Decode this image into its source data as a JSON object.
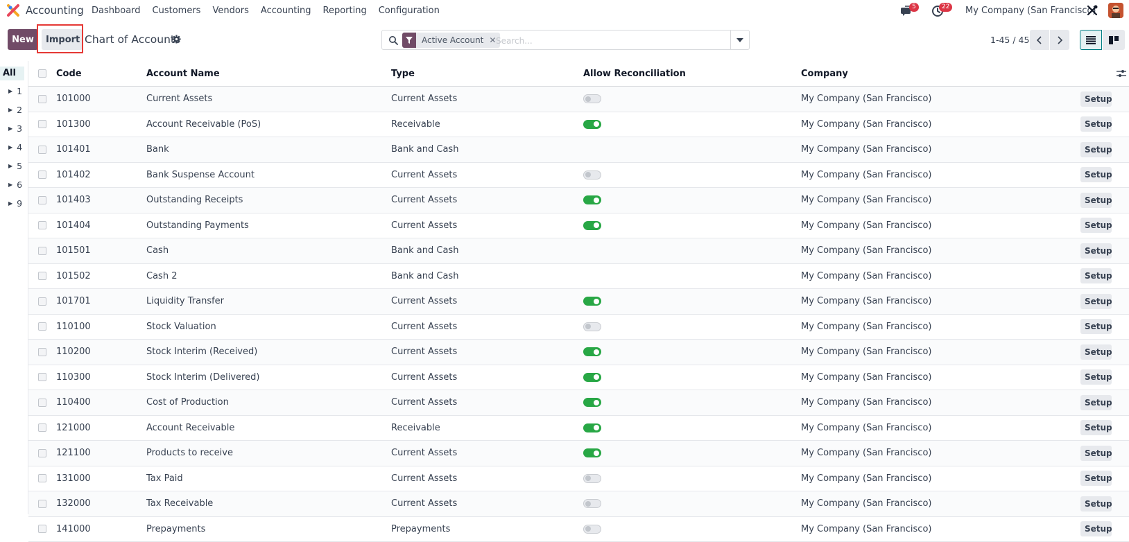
{
  "navbar": {
    "app_name": "Accounting",
    "menu": [
      "Dashboard",
      "Customers",
      "Vendors",
      "Accounting",
      "Reporting",
      "Configuration"
    ],
    "chat_badge": "5",
    "activity_badge": "22",
    "company": "My Company (San Francisco)"
  },
  "control": {
    "new_label": "New",
    "import_label": "Import",
    "title": "Chart of Accounts",
    "facet_label": "Active Account",
    "search_placeholder": "Search...",
    "pager": "1-45 / 45"
  },
  "side_panel": {
    "all_label": "All",
    "groups": [
      "1",
      "2",
      "3",
      "4",
      "5",
      "6",
      "9"
    ]
  },
  "table": {
    "headers": {
      "code": "Code",
      "name": "Account Name",
      "type": "Type",
      "reconcile": "Allow Reconciliation",
      "company": "Company"
    },
    "setup_label": "Setup",
    "rows": [
      {
        "code": "101000",
        "name": "Current Assets",
        "type": "Current Assets",
        "reconcile": "off",
        "company": "My Company (San Francisco)"
      },
      {
        "code": "101300",
        "name": "Account Receivable (PoS)",
        "type": "Receivable",
        "reconcile": "on",
        "company": "My Company (San Francisco)"
      },
      {
        "code": "101401",
        "name": "Bank",
        "type": "Bank and Cash",
        "reconcile": "none",
        "company": "My Company (San Francisco)"
      },
      {
        "code": "101402",
        "name": "Bank Suspense Account",
        "type": "Current Assets",
        "reconcile": "off",
        "company": "My Company (San Francisco)"
      },
      {
        "code": "101403",
        "name": "Outstanding Receipts",
        "type": "Current Assets",
        "reconcile": "on",
        "company": "My Company (San Francisco)"
      },
      {
        "code": "101404",
        "name": "Outstanding Payments",
        "type": "Current Assets",
        "reconcile": "on",
        "company": "My Company (San Francisco)"
      },
      {
        "code": "101501",
        "name": "Cash",
        "type": "Bank and Cash",
        "reconcile": "none",
        "company": "My Company (San Francisco)"
      },
      {
        "code": "101502",
        "name": "Cash 2",
        "type": "Bank and Cash",
        "reconcile": "none",
        "company": "My Company (San Francisco)"
      },
      {
        "code": "101701",
        "name": "Liquidity Transfer",
        "type": "Current Assets",
        "reconcile": "on",
        "company": "My Company (San Francisco)"
      },
      {
        "code": "110100",
        "name": "Stock Valuation",
        "type": "Current Assets",
        "reconcile": "off",
        "company": "My Company (San Francisco)"
      },
      {
        "code": "110200",
        "name": "Stock Interim (Received)",
        "type": "Current Assets",
        "reconcile": "on",
        "company": "My Company (San Francisco)"
      },
      {
        "code": "110300",
        "name": "Stock Interim (Delivered)",
        "type": "Current Assets",
        "reconcile": "on",
        "company": "My Company (San Francisco)"
      },
      {
        "code": "110400",
        "name": "Cost of Production",
        "type": "Current Assets",
        "reconcile": "on",
        "company": "My Company (San Francisco)"
      },
      {
        "code": "121000",
        "name": "Account Receivable",
        "type": "Receivable",
        "reconcile": "on",
        "company": "My Company (San Francisco)"
      },
      {
        "code": "121100",
        "name": "Products to receive",
        "type": "Current Assets",
        "reconcile": "on",
        "company": "My Company (San Francisco)"
      },
      {
        "code": "131000",
        "name": "Tax Paid",
        "type": "Current Assets",
        "reconcile": "off",
        "company": "My Company (San Francisco)"
      },
      {
        "code": "132000",
        "name": "Tax Receivable",
        "type": "Current Assets",
        "reconcile": "off",
        "company": "My Company (San Francisco)"
      },
      {
        "code": "141000",
        "name": "Prepayments",
        "type": "Prepayments",
        "reconcile": "off",
        "company": "My Company (San Francisco)"
      }
    ]
  },
  "colors": {
    "brand": "#714b67",
    "toggle_on": "#28a745",
    "badge": "#dc3545",
    "highlight": "#e53935",
    "active_view": "#017e84"
  }
}
